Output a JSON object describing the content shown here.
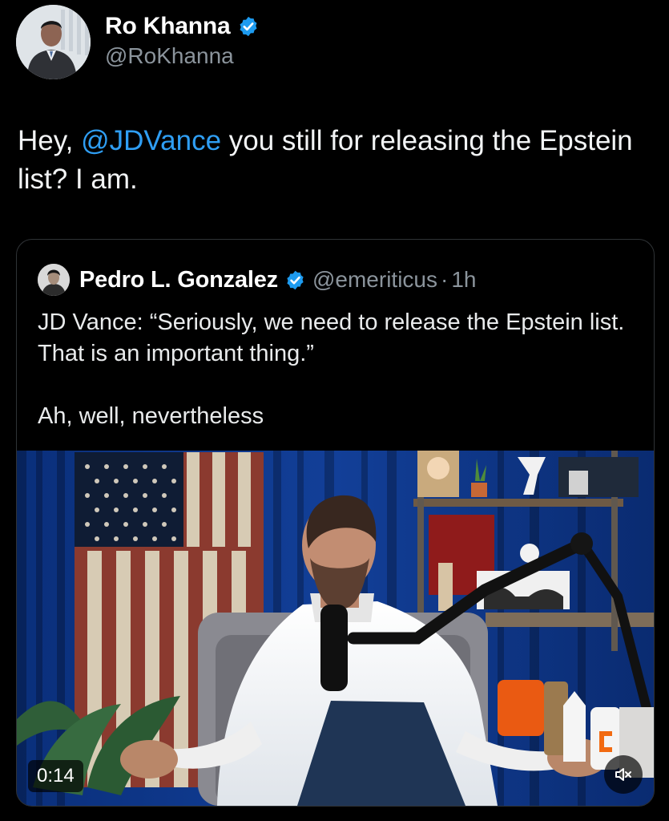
{
  "tweet": {
    "author": {
      "name": "Ro Khanna",
      "handle": "@RoKhanna",
      "verified": true
    },
    "text_prefix": "Hey, ",
    "mention": "@JDVance",
    "text_suffix": " you still for releasing the Epstein list? I am."
  },
  "quoted_tweet": {
    "author": {
      "name": "Pedro L. Gonzalez",
      "handle": "@emeriticus",
      "verified": true
    },
    "separator": "·",
    "time": "1h",
    "text_line1": "JD Vance: “Seriously, we need to release the Epstein list. That is an important thing.”",
    "text_line2": "Ah, well, nevertheless",
    "video": {
      "duration": "0:14",
      "mute_icon": "speaker-muted-icon"
    }
  },
  "colors": {
    "background": "#000000",
    "text": "#e7e9ea",
    "secondary_text": "#8b949c",
    "mention_blue": "#2f9ef3",
    "verified_blue": "#1d9bf0",
    "card_border": "#2f3336"
  }
}
